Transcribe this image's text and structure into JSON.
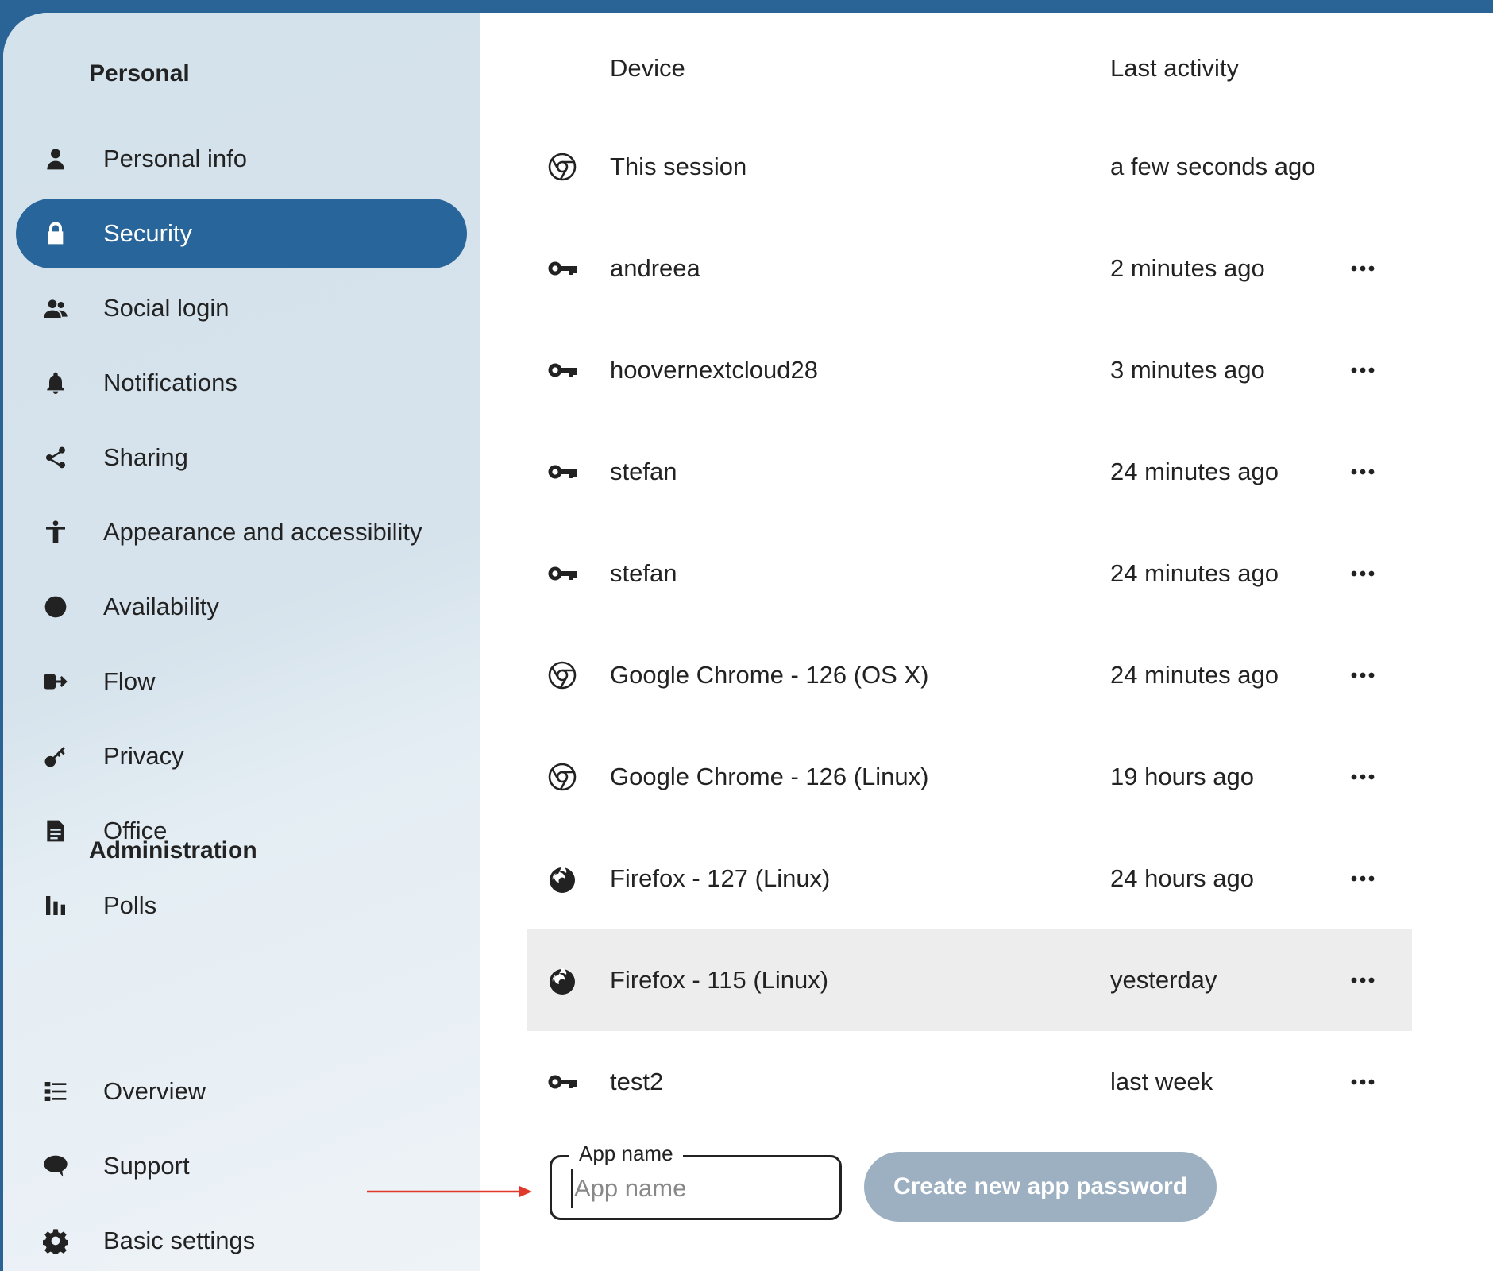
{
  "colors": {
    "accent": "#28659a",
    "arrow": "#e0392b",
    "button_disabled": "#9db0c2",
    "highlight_row": "#ededed"
  },
  "sidebar": {
    "personal_heading": "Personal",
    "admin_heading": "Administration",
    "personal_items": [
      {
        "label": "Personal info",
        "icon": "user-icon"
      },
      {
        "label": "Security",
        "icon": "lock-icon",
        "active": true
      },
      {
        "label": "Social login",
        "icon": "users-icon"
      },
      {
        "label": "Notifications",
        "icon": "bell-icon"
      },
      {
        "label": "Sharing",
        "icon": "share-icon"
      },
      {
        "label": "Appearance and accessibility",
        "icon": "accessibility-icon"
      },
      {
        "label": "Availability",
        "icon": "clock-icon"
      },
      {
        "label": "Flow",
        "icon": "flow-icon"
      },
      {
        "label": "Privacy",
        "icon": "key-icon"
      },
      {
        "label": "Office",
        "icon": "document-icon"
      },
      {
        "label": "Polls",
        "icon": "poll-icon"
      }
    ],
    "admin_items": [
      {
        "label": "Overview",
        "icon": "list-icon"
      },
      {
        "label": "Support",
        "icon": "chat-icon"
      },
      {
        "label": "Basic settings",
        "icon": "gear-icon"
      }
    ]
  },
  "sessions": {
    "headers": {
      "device": "Device",
      "last_activity": "Last activity"
    },
    "rows": [
      {
        "device": "This session",
        "activity": "a few seconds ago",
        "icon": "chrome-icon",
        "menu": false
      },
      {
        "device": "andreea",
        "activity": "2 minutes ago",
        "icon": "key-icon",
        "menu": true
      },
      {
        "device": "hoovernextcloud28",
        "activity": "3 minutes ago",
        "icon": "key-icon",
        "menu": true
      },
      {
        "device": "stefan",
        "activity": "24 minutes ago",
        "icon": "key-icon",
        "menu": true
      },
      {
        "device": "stefan",
        "activity": "24 minutes ago",
        "icon": "key-icon",
        "menu": true
      },
      {
        "device": "Google Chrome - 126 (OS X)",
        "activity": "24 minutes ago",
        "icon": "chrome-icon",
        "menu": true
      },
      {
        "device": "Google Chrome - 126 (Linux)",
        "activity": "19 hours ago",
        "icon": "chrome-icon",
        "menu": true
      },
      {
        "device": "Firefox - 127 (Linux)",
        "activity": "24 hours ago",
        "icon": "firefox-icon",
        "menu": true
      },
      {
        "device": "Firefox - 115 (Linux)",
        "activity": "yesterday",
        "icon": "firefox-icon",
        "menu": true,
        "highlighted": true
      },
      {
        "device": "test2",
        "activity": "last week",
        "icon": "key-icon",
        "menu": true
      }
    ]
  },
  "app_password": {
    "field_label": "App name",
    "placeholder": "App name",
    "value": "",
    "button_label": "Create new app password"
  }
}
